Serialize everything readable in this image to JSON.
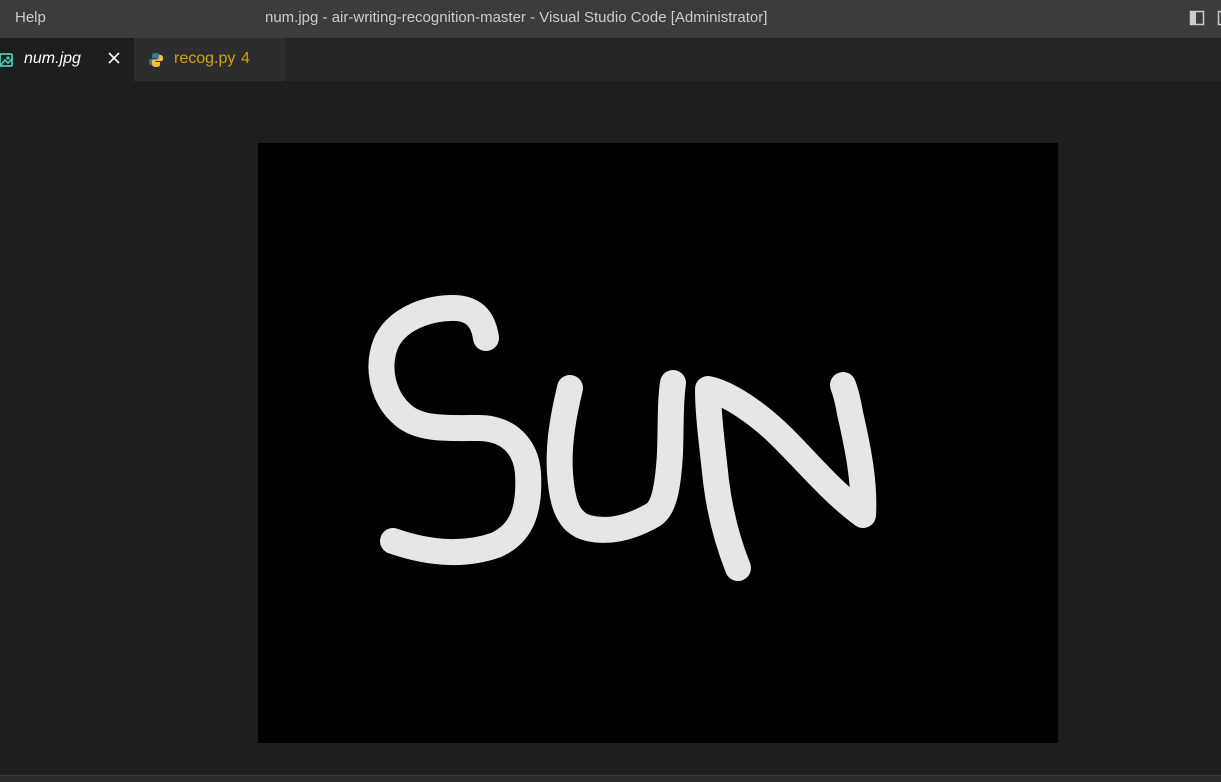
{
  "titlebar": {
    "menu_help": "Help",
    "window_title": "num.jpg - air-writing-recognition-master - Visual Studio Code [Administrator]"
  },
  "tabs": [
    {
      "label": "num.jpg",
      "icon": "image-file-icon",
      "active": true
    },
    {
      "label": "recog.py",
      "icon": "python-file-icon",
      "badge": "4",
      "active": false
    }
  ],
  "image_preview": {
    "content_description_text": "SUN"
  },
  "colors": {
    "titlebar_bg": "#3c3c3c",
    "editor_bg": "#1e1e1e",
    "warning_tab_text": "#cca700",
    "stroke": "#e6e6e6"
  }
}
